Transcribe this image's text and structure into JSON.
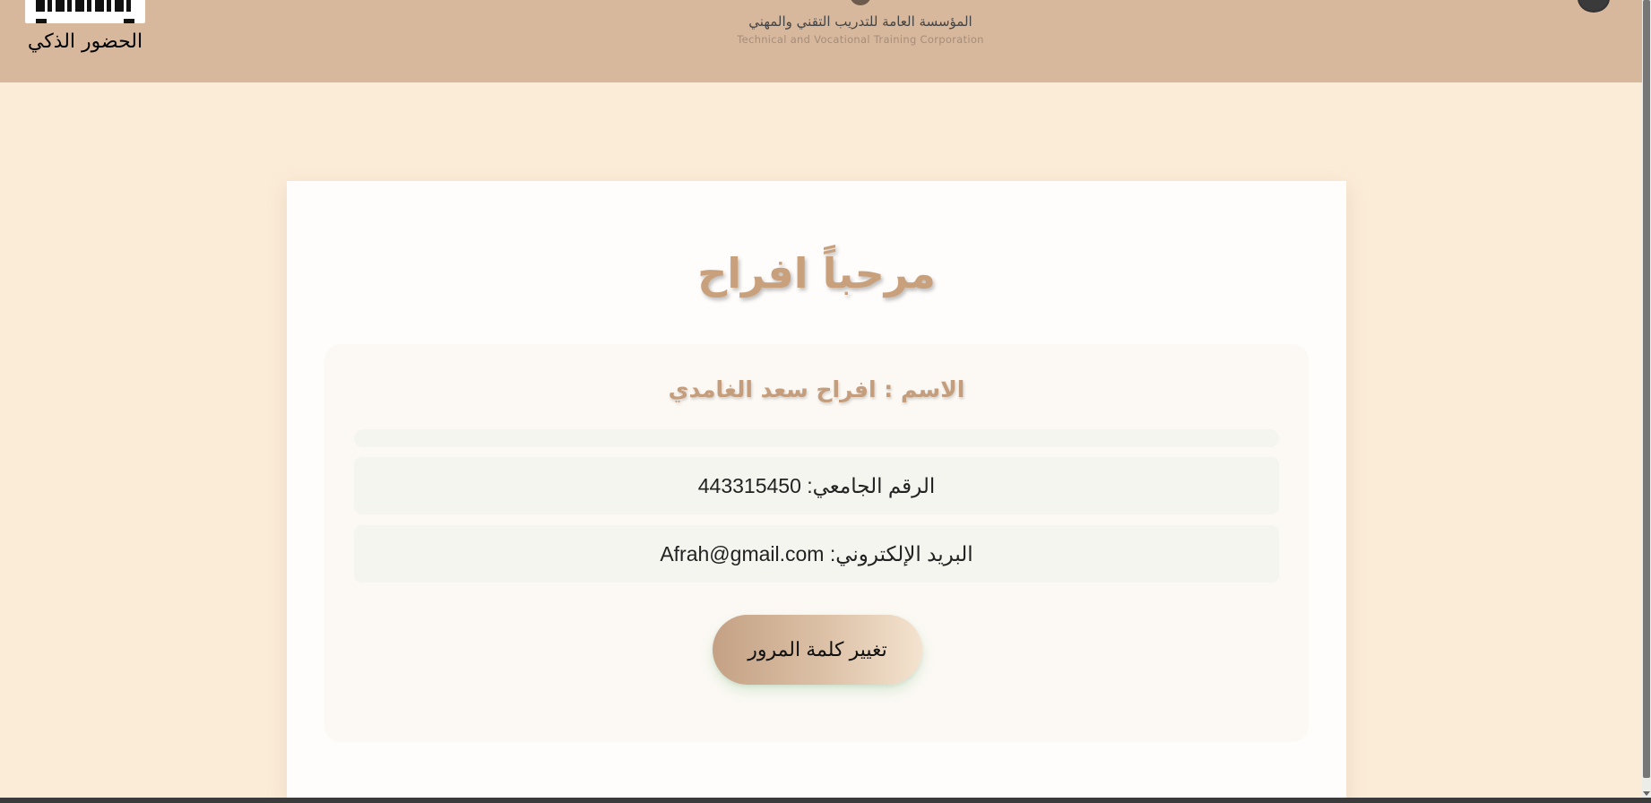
{
  "header": {
    "app_title": "الحضور الذكي",
    "org_name_ar": "المؤسسة العامة للتدريب التقني والمهني",
    "org_name_en": "Technical and Vocational Training Corporation"
  },
  "main": {
    "welcome": "مرحباً افراح",
    "name_line": "الاسم : افراح سعد الغامدي",
    "student_id_label": "الرقم الجامعي:",
    "student_id": "443315450",
    "email_label": "البريد الإلكتروني:",
    "email": "Afrah@gmail.com",
    "change_password_label": "تغيير كلمة المرور"
  },
  "colors": {
    "header_bg": "#d8b89c",
    "page_bg": "#fbecd8",
    "accent": "#c9a07c"
  },
  "icons": [
    "qr-logo-icon",
    "org-emblem-icon",
    "globe-icon"
  ]
}
